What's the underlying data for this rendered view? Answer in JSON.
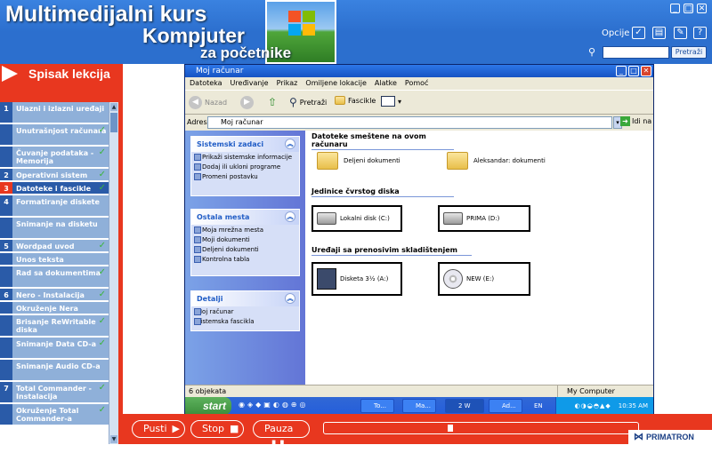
{
  "header": {
    "title1": "Multimedijalni kurs",
    "title2": "Kompjuter",
    "title3": "za početnike",
    "options_label": "Opcije",
    "search_button": "Pretraži"
  },
  "sidebar": {
    "title": "Spisak lekcija",
    "items": [
      {
        "num": "1",
        "label": "Ulazni i izlazni uređaji",
        "check": "",
        "active": false
      },
      {
        "num": "",
        "label": "Unutrašnjost računara",
        "check": "✓",
        "active": false
      },
      {
        "num": "",
        "label": "Čuvanje podataka - Memorija",
        "check": "✓",
        "active": false
      },
      {
        "num": "2",
        "label": "Operativni sistem",
        "check": "✓",
        "active": false
      },
      {
        "num": "3",
        "label": "Datoteke i fascikle",
        "check": "✓",
        "active": true
      },
      {
        "num": "4",
        "label": "Formatiranje diskete",
        "check": "",
        "active": false
      },
      {
        "num": "",
        "label": "Snimanje na disketu",
        "check": "",
        "active": false
      },
      {
        "num": "5",
        "label": "Wordpad uvod",
        "check": "✓",
        "active": false
      },
      {
        "num": "",
        "label": "Unos teksta",
        "check": "",
        "active": false
      },
      {
        "num": "",
        "label": "Rad sa dokumentima",
        "check": "✓",
        "active": false
      },
      {
        "num": "6",
        "label": "Nero - Instalacija",
        "check": "✓",
        "active": false
      },
      {
        "num": "",
        "label": "Okruženje Nera",
        "check": "",
        "active": false
      },
      {
        "num": "",
        "label": "Brisanje ReWritable diska",
        "check": "✓",
        "active": false
      },
      {
        "num": "",
        "label": "Snimanje Data CD-a",
        "check": "✓",
        "active": false
      },
      {
        "num": "",
        "label": "Snimanje Audio CD-a",
        "check": "",
        "active": false
      },
      {
        "num": "7",
        "label": "Total Commander - Instalacija",
        "check": "✓",
        "active": false
      },
      {
        "num": "",
        "label": "Okruženje Total Commander-a",
        "check": "✓",
        "active": false
      }
    ]
  },
  "explorer": {
    "title": "Moj računar",
    "menu": [
      "Datoteka",
      "Uređivanje",
      "Prikaz",
      "Omiljene lokacije",
      "Alatke",
      "Pomoć"
    ],
    "toolbar": {
      "back": "Nazad",
      "search": "Pretraži",
      "folders": "Fascikle"
    },
    "address_label": "Adresa",
    "address_value": "Moj računar",
    "go_label": "Idi na",
    "panels": [
      {
        "title": "Sistemski zadaci",
        "items": [
          "Prikaži sistemske informacije",
          "Dodaj ili ukloni programe",
          "Promeni postavku"
        ]
      },
      {
        "title": "Ostala mesta",
        "items": [
          "Moja mrežna mesta",
          "Moji dokumenti",
          "Deljeni dokumenti",
          "Kontrolna tabla"
        ]
      },
      {
        "title": "Detalji",
        "items": [
          "Moj računar",
          "Sistemska fascikla"
        ]
      }
    ],
    "sections": {
      "shared": "Datoteke smeštene na ovom računaru",
      "hard": "Jedinice čvrstog diska",
      "removable": "Uređaji sa prenosivim skladištenjem"
    },
    "folders": [
      "Deljeni dokumenti",
      "Aleksandar: dokumenti"
    ],
    "drives": [
      "Lokalni disk (C:)",
      "PRIMA (D:)"
    ],
    "devices": [
      "Disketa 3½ (A:)",
      "NEW (E:)"
    ],
    "status_left": "6 objekata",
    "status_right": "My Computer",
    "taskbar": {
      "start": "start",
      "tasks": [
        "To...",
        "Ma...",
        "2 W",
        "Ad..."
      ],
      "lang": "EN",
      "clock": "10:35 AM"
    }
  },
  "controls": {
    "play": "Pusti",
    "stop": "Stop",
    "pause": "Pauza",
    "progress": 0.41
  },
  "brand": "PRIMATRON",
  "colors": {
    "red": "#e8371f",
    "blue": "#2c6fce",
    "active_item": "#2a5ba8"
  }
}
